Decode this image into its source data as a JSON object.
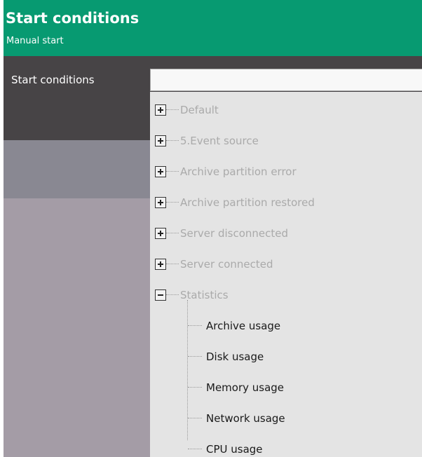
{
  "header": {
    "title": "Start conditions",
    "subtitle": "Manual start"
  },
  "form": {
    "start_conditions_label": "Start conditions",
    "start_conditions_value": ""
  },
  "dropdown": {
    "groups": [
      {
        "label": "Default",
        "expanded": false
      },
      {
        "label": "5.Event source",
        "expanded": false
      },
      {
        "label": "Archive partition error",
        "expanded": false
      },
      {
        "label": "Archive partition restored",
        "expanded": false
      },
      {
        "label": "Server disconnected",
        "expanded": false
      },
      {
        "label": "Server connected",
        "expanded": false
      },
      {
        "label": "Statistics",
        "expanded": true
      }
    ],
    "statistics_children": [
      {
        "label": "Archive usage"
      },
      {
        "label": "Disk usage"
      },
      {
        "label": "Memory usage"
      },
      {
        "label": "Network usage"
      },
      {
        "label": "CPU usage"
      }
    ]
  },
  "colors": {
    "header_bg": "#079a71",
    "dark_row_bg": "#474446",
    "grey_row_bg": "#898892",
    "panel_bg": "#a49ca6",
    "dropdown_bg": "#e4e4e4",
    "disabled_text": "#aaaaaa"
  },
  "icons": {
    "expand": "plus-box-icon",
    "collapse": "minus-box-icon"
  }
}
